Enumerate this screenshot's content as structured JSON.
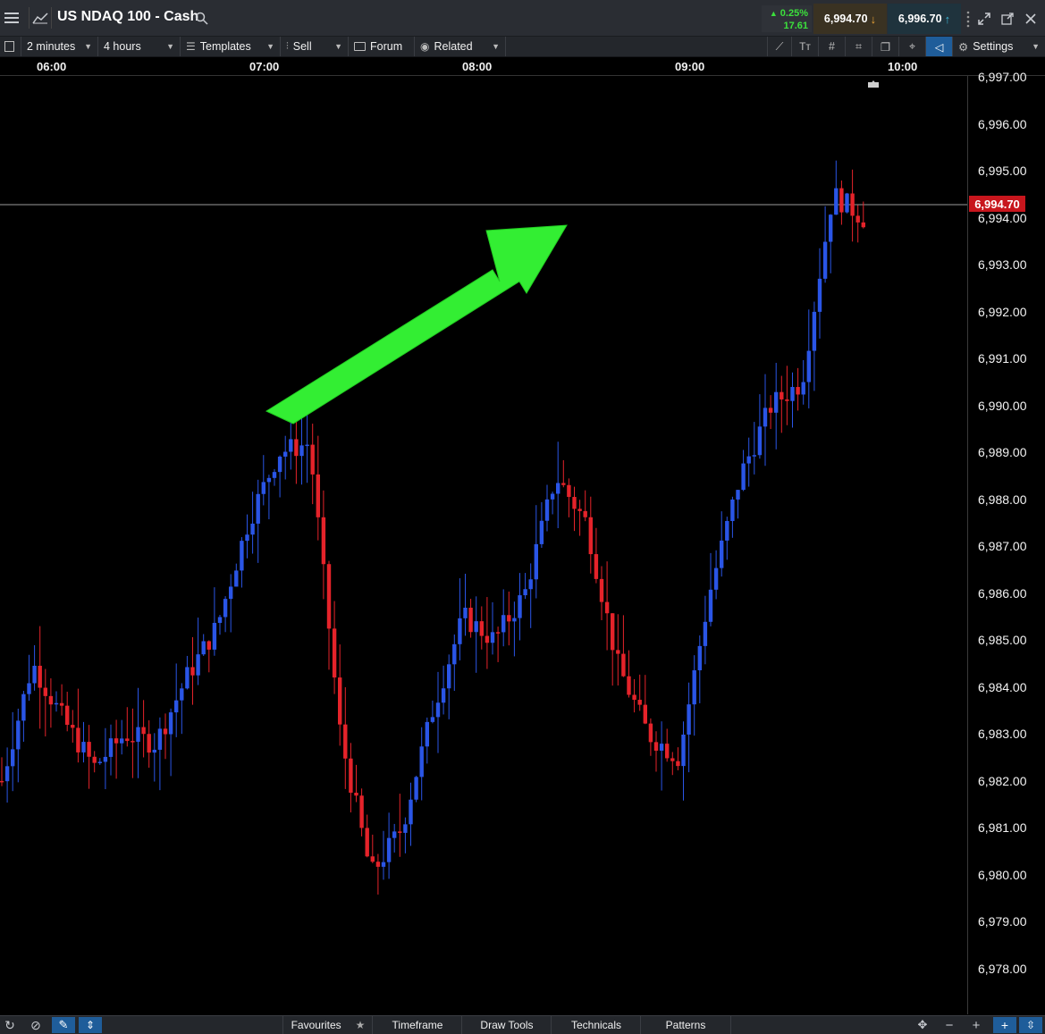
{
  "header": {
    "title": "US NDAQ 100 - Cash",
    "change_pct": "0.25%",
    "change_abs": "17.61",
    "sell_price": "6,994.70",
    "buy_price": "6,996.70"
  },
  "toolbar": {
    "interval": "2 minutes",
    "range": "4 hours",
    "templates": "Templates",
    "sell": "Sell",
    "forum": "Forum",
    "related": "Related",
    "settings": "Settings"
  },
  "time_axis": [
    "06:00",
    "07:00",
    "08:00",
    "09:00",
    "10:00"
  ],
  "price_axis": [
    "6,997.00",
    "6,996.00",
    "6,995.00",
    "6,994.00",
    "6,993.00",
    "6,992.00",
    "6,991.00",
    "6,990.00",
    "6,989.00",
    "6,988.00",
    "6,987.00",
    "6,986.00",
    "6,985.00",
    "6,984.00",
    "6,983.00",
    "6,982.00",
    "6,981.00",
    "6,980.00",
    "6,979.00",
    "6,978.00"
  ],
  "current_price_label": "6,994.70",
  "bottom": {
    "favourites": "Favourites",
    "timeframe": "Timeframe",
    "draw_tools": "Draw Tools",
    "technicals": "Technicals",
    "patterns": "Patterns"
  },
  "colors": {
    "up": "#2a55e6",
    "down": "#e5232a",
    "arrow": "#33ee33",
    "price_tag": "#c8161d"
  },
  "chart_data": {
    "type": "candlestick",
    "x_unit": "time (2-minute bars)",
    "y_range": [
      6977.5,
      6997.0
    ],
    "current_price": 6994.7,
    "approx_closes": [
      6982.0,
      6984.5,
      6983.3,
      6982.3,
      6983.0,
      6982.8,
      6984.2,
      6985.3,
      6987.5,
      6989.0,
      6989.2,
      6983.0,
      6980.0,
      6981.0,
      6983.5,
      6985.5,
      6985.0,
      6986.0,
      6988.5,
      6987.5,
      6984.5,
      6983.0,
      6982.5,
      6986.0,
      6988.5,
      6990.0,
      6990.5,
      6994.5,
      6994.0
    ]
  }
}
